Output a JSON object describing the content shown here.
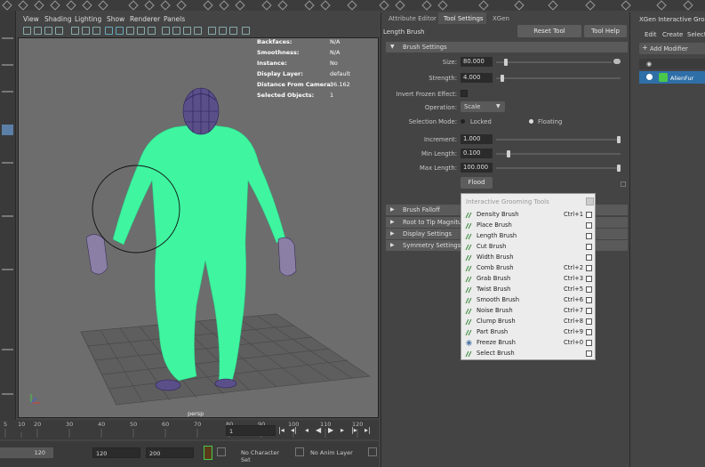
{
  "viewport": {
    "menus": [
      "View",
      "Shading",
      "Lighting",
      "Show",
      "Renderer",
      "Panels"
    ],
    "hud": [
      {
        "label": "Backfaces:",
        "value": "N/A"
      },
      {
        "label": "Smoothness:",
        "value": "N/A"
      },
      {
        "label": "Instance:",
        "value": "No"
      },
      {
        "label": "Display Layer:",
        "value": "default"
      },
      {
        "label": "Distance From Camera:",
        "value": "36.162"
      },
      {
        "label": "Selected Objects:",
        "value": "1"
      }
    ],
    "camera": "persp"
  },
  "timeline": {
    "ticks": [
      "5",
      "10",
      "20",
      "30",
      "40",
      "50",
      "60",
      "70",
      "80",
      "90",
      "100",
      "110",
      "120"
    ],
    "current_frame": "1",
    "range_start_left": "120",
    "range_start": "120",
    "range_end": "200",
    "character_set": "No Character Set",
    "anim_layer": "No Anim Layer"
  },
  "attribute_editor": {
    "tabs": [
      "Attribute Editor",
      "Tool Settings",
      "XGen"
    ],
    "active_tab": "Tool Settings",
    "tool_name": "Length Brush",
    "reset_button": "Reset Tool",
    "help_button": "Tool Help",
    "brush_settings_title": "Brush Settings",
    "size_label": "Size:",
    "size_value": "80.000",
    "strength_label": "Strength:",
    "strength_value": "4.000",
    "invert_frozen_label": "Invert Frozen Effect:",
    "operation_label": "Operation:",
    "operation_value": "Scale",
    "selection_mode_label": "Selection Mode:",
    "selection_locked": "Locked",
    "selection_floating": "Floating",
    "increment_label": "Increment:",
    "increment_value": "1.000",
    "min_length_label": "Min Length:",
    "min_length_value": "0.100",
    "max_length_label": "Max Length:",
    "max_length_value": "100.000",
    "flood_button": "Flood",
    "sections": [
      "Brush Falloff",
      "Root to Tip Magnitu",
      "Display Settings",
      "Symmetry Settings"
    ]
  },
  "popup": {
    "title": "Interactive Grooming Tools",
    "items": [
      {
        "label": "Density Brush",
        "shortcut": "Ctrl+1",
        "icon": "density-brush-icon"
      },
      {
        "label": "Place Brush",
        "shortcut": "",
        "icon": "place-brush-icon"
      },
      {
        "label": "Length Brush",
        "shortcut": "",
        "icon": "length-brush-icon"
      },
      {
        "label": "Cut Brush",
        "shortcut": "",
        "icon": "cut-brush-icon"
      },
      {
        "label": "Width Brush",
        "shortcut": "",
        "icon": "width-brush-icon"
      },
      {
        "label": "Comb Brush",
        "shortcut": "Ctrl+2",
        "icon": "comb-brush-icon"
      },
      {
        "label": "Grab Brush",
        "shortcut": "Ctrl+3",
        "icon": "grab-brush-icon"
      },
      {
        "label": "Twist Brush",
        "shortcut": "Ctrl+5",
        "icon": "twist-brush-icon"
      },
      {
        "label": "Smooth Brush",
        "shortcut": "Ctrl+6",
        "icon": "smooth-brush-icon"
      },
      {
        "label": "Noise Brush",
        "shortcut": "Ctrl+7",
        "icon": "noise-brush-icon"
      },
      {
        "label": "Clump Brush",
        "shortcut": "Ctrl+8",
        "icon": "clump-brush-icon"
      },
      {
        "label": "Part Brush",
        "shortcut": "Ctrl+9",
        "icon": "part-brush-icon"
      },
      {
        "label": "Freeze Brush",
        "shortcut": "Ctrl+0",
        "icon": "freeze-brush-icon"
      },
      {
        "label": "Select Brush",
        "shortcut": "",
        "icon": "select-brush-icon"
      }
    ]
  },
  "xgen": {
    "title": "XGen Interactive Groom",
    "menus": [
      "Edit",
      "Create",
      "Select"
    ],
    "add_modifier": "Add Modifier",
    "description": "AlienFur"
  },
  "colors": {
    "fur": "#3ff5a0",
    "selection_blue": "#2f6fa8"
  }
}
